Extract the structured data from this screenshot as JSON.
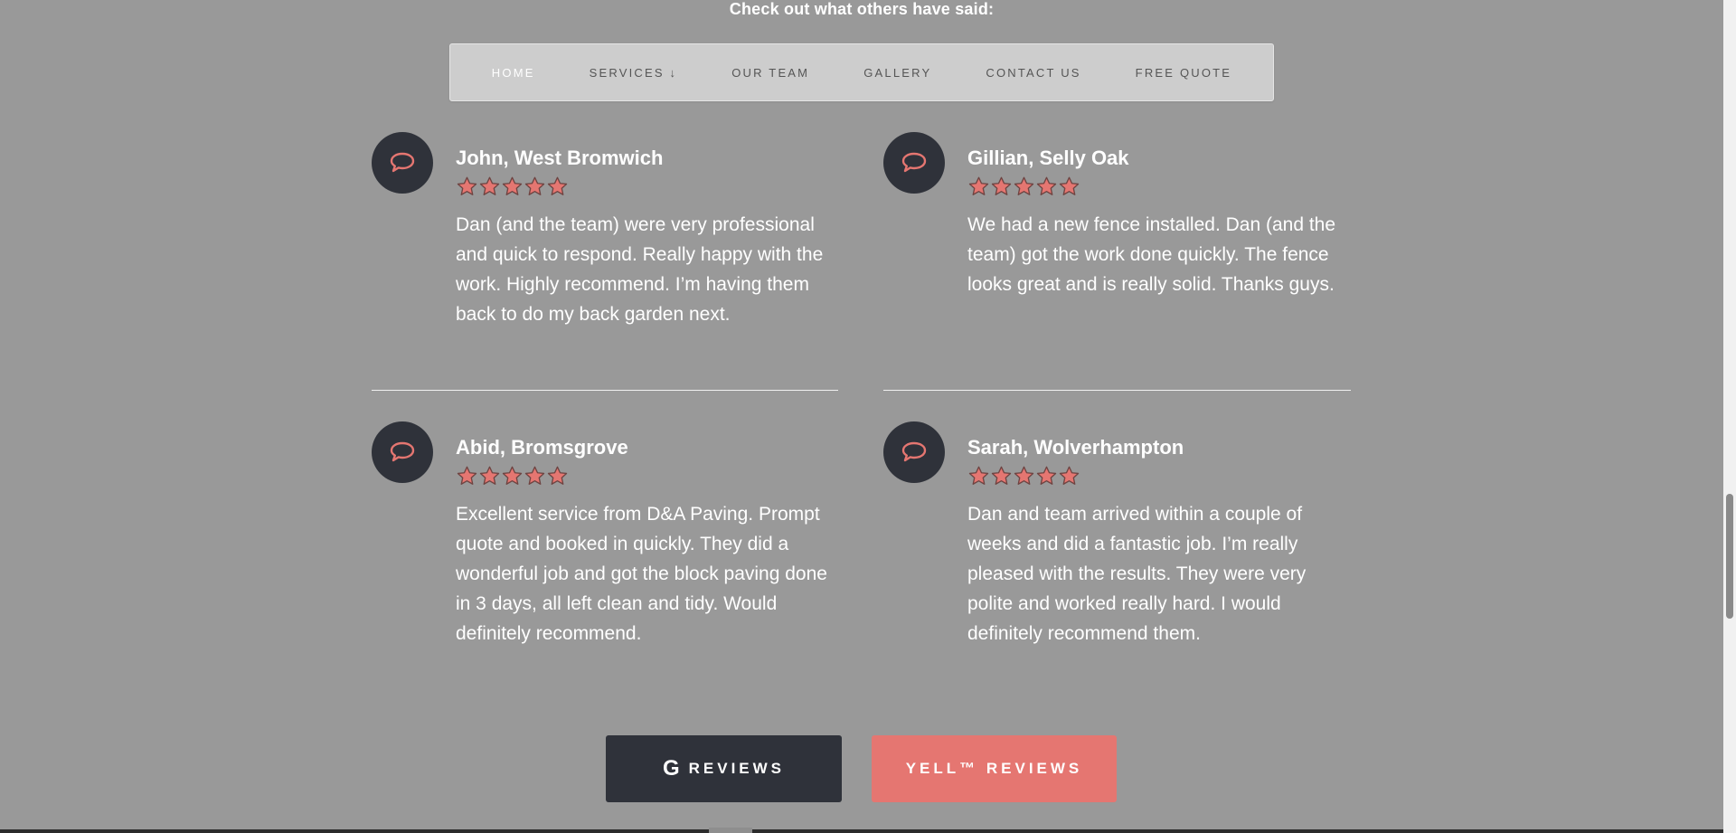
{
  "heading": "Check out what others have said:",
  "nav": {
    "items": [
      {
        "label": "HOME",
        "active": true
      },
      {
        "label": "SERVICES ↓",
        "active": false
      },
      {
        "label": "OUR TEAM",
        "active": false
      },
      {
        "label": "GALLERY",
        "active": false
      },
      {
        "label": "CONTACT US",
        "active": false
      },
      {
        "label": "FREE QUOTE",
        "active": false
      }
    ]
  },
  "reviews": [
    {
      "name": "John, West Bromwich",
      "rating": 5,
      "text": "Dan (and the team) were very professional and quick to respond. Really happy with the work. Highly recommend. I’m having them back to do my back garden next."
    },
    {
      "name": "Gillian, Selly Oak",
      "rating": 5,
      "text": "We had a new fence installed. Dan (and the team) got the work done quickly. The fence looks great and is really solid. Thanks guys."
    },
    {
      "name": "Abid, Bromsgrove",
      "rating": 5,
      "text": "Excellent service from D&A Paving. Prompt quote and booked in quickly. They did a wonderful job and got the block paving done in 3 days, all left clean and tidy. Would definitely recommend."
    },
    {
      "name": "Sarah, Wolverhampton",
      "rating": 5,
      "text": "Dan and team arrived within a couple of weeks and did a fantastic job. I’m really pleased with the results. They were very polite and worked really hard. I would definitely recommend them."
    }
  ],
  "buttons": {
    "google_glyph": "G",
    "google_label": "REVIEWS",
    "yell_label": "YELL™ REVIEWS"
  },
  "colors": {
    "background": "#999999",
    "accent": "#e57671",
    "dark": "#2f323a"
  },
  "icons": {
    "review_bubble": "speech-bubble-icon",
    "rating": "star-icon"
  }
}
